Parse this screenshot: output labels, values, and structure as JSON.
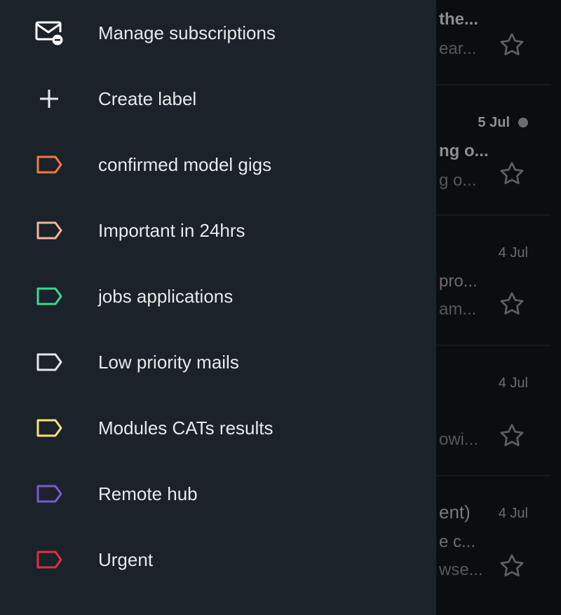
{
  "inbox": {
    "rows": [
      {
        "sender": "the...",
        "subject": "",
        "snippet": "ear...",
        "date": "",
        "unread_dot": false
      },
      {
        "sender": "ng o...",
        "subject": "",
        "snippet": "g o...",
        "date": "5 Jul",
        "unread_dot": true
      },
      {
        "sender": "",
        "subject": "pro...",
        "snippet": "am...",
        "date": "4 Jul",
        "unread_dot": false
      },
      {
        "sender": "",
        "subject": "",
        "snippet": "owi...",
        "date": "4 Jul",
        "unread_dot": false
      },
      {
        "sender": "ent)",
        "subject": "e c...",
        "snippet": "wse...",
        "date": "4 Jul",
        "unread_dot": false
      }
    ],
    "star_icon": "star-outline-icon"
  },
  "drawer": {
    "items": [
      {
        "label": "Manage subscriptions",
        "icon": "mail-unsubscribe-icon"
      },
      {
        "label": "Create label",
        "icon": "plus-icon"
      },
      {
        "label": "confirmed model gigs",
        "icon": "label-icon",
        "color": "#f07a3f"
      },
      {
        "label": "Important in 24hrs",
        "icon": "label-icon",
        "color": "#f4b49b"
      },
      {
        "label": "jobs applications",
        "icon": "label-icon",
        "color": "#3ed690"
      },
      {
        "label": "Low priority mails",
        "icon": "label-icon",
        "color": "#e4e6ea"
      },
      {
        "label": "Modules CATs results",
        "icon": "label-icon",
        "color": "#f6e27a"
      },
      {
        "label": "Remote hub",
        "icon": "label-icon",
        "color": "#7a58d8"
      },
      {
        "label": "Urgent",
        "icon": "label-icon",
        "color": "#e0303a"
      }
    ]
  }
}
